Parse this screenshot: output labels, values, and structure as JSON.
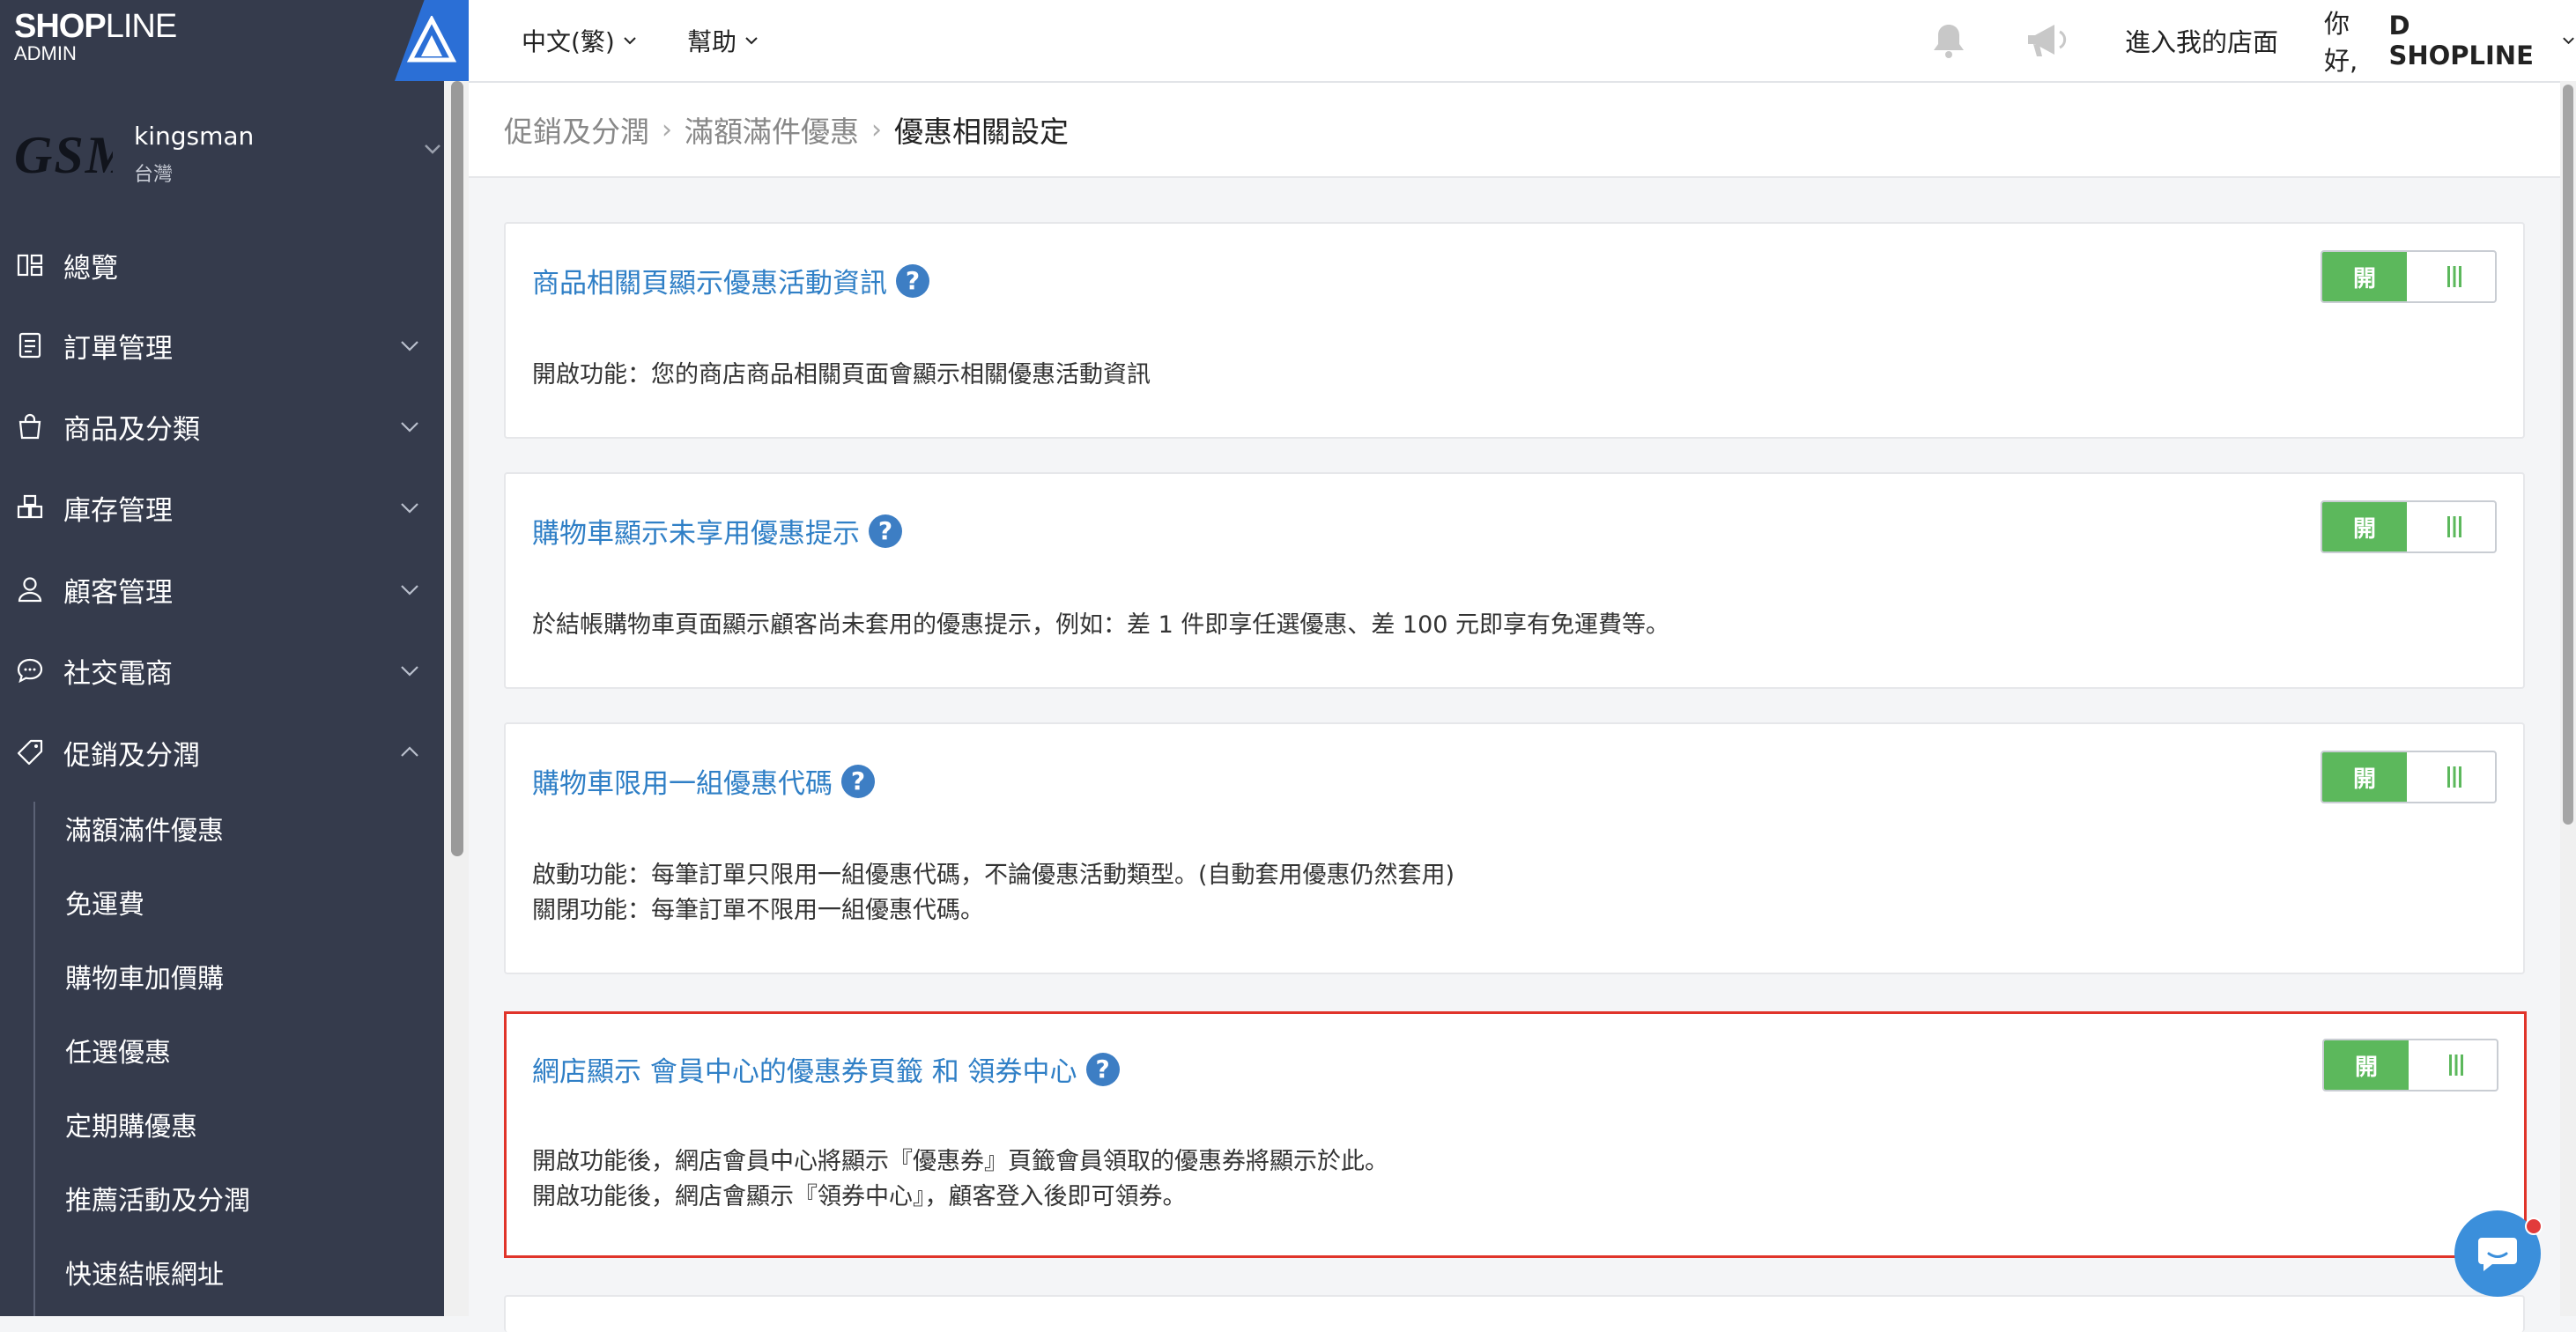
{
  "brand": {
    "logo_bold": "SHOP",
    "logo_thin": "LINE",
    "logo_sub": "ADMIN"
  },
  "store": {
    "avatar_text": "GSM",
    "name": "kingsman",
    "region": "台灣"
  },
  "sidebar": {
    "items": [
      {
        "label": "總覽",
        "icon": "dashboard-icon",
        "has_chevron": false
      },
      {
        "label": "訂單管理",
        "icon": "order-icon",
        "has_chevron": true
      },
      {
        "label": "商品及分類",
        "icon": "shopping-bag-icon",
        "has_chevron": true
      },
      {
        "label": "庫存管理",
        "icon": "inventory-icon",
        "has_chevron": true
      },
      {
        "label": "顧客管理",
        "icon": "user-icon",
        "has_chevron": true
      },
      {
        "label": "社交電商",
        "icon": "chat-bubble-icon",
        "has_chevron": true
      },
      {
        "label": "促銷及分潤",
        "icon": "tag-icon",
        "has_chevron": true,
        "expanded": true
      }
    ],
    "subitems": [
      {
        "label": "滿額滿件優惠"
      },
      {
        "label": "免運費"
      },
      {
        "label": "購物車加價購"
      },
      {
        "label": "任選優惠"
      },
      {
        "label": "定期購優惠"
      },
      {
        "label": "推薦活動及分潤"
      },
      {
        "label": "快速結帳網址"
      }
    ]
  },
  "header": {
    "language": "中文(繁)",
    "help": "幫助",
    "enter_store": "進入我的店面",
    "greeting_prefix": "你好,",
    "greeting_name": "D SHOPLINE"
  },
  "breadcrumb": [
    "促銷及分潤",
    "滿額滿件優惠",
    "優惠相關設定"
  ],
  "cards": [
    {
      "title": "商品相關頁顯示優惠活動資訊",
      "toggle_label": "開",
      "toggle_on": true,
      "lines": [
        "開啟功能：您的商店商品相關頁面會顯示相關優惠活動資訊"
      ]
    },
    {
      "title": "購物車顯示未享用優惠提示",
      "toggle_label": "開",
      "toggle_on": true,
      "lines": [
        "於結帳購物車頁面顯示顧客尚未套用的優惠提示，例如：差 1 件即享任選優惠、差 100 元即享有免運費等。"
      ]
    },
    {
      "title": "購物車限用一組優惠代碼",
      "toggle_label": "開",
      "toggle_on": true,
      "lines": [
        "啟動功能：每筆訂單只限用一組優惠代碼，不論優惠活動類型。(自動套用優惠仍然套用)",
        "關閉功能：每筆訂單不限用一組優惠代碼。"
      ]
    },
    {
      "title": "網店顯示 會員中心的優惠券頁籤 和 領券中心",
      "toggle_label": "開",
      "toggle_on": true,
      "lines": [
        "開啟功能後，網店會員中心將顯示『優惠券』頁籤會員領取的優惠券將顯示於此。",
        "開啟功能後，網店會顯示『領券中心』，顧客登入後即可領券。"
      ]
    }
  ],
  "colors": {
    "sidebar_bg": "#353b4c",
    "link_blue": "#2f7fc6",
    "toggle_green": "#5cb85c",
    "highlight_red": "#e0342a"
  }
}
